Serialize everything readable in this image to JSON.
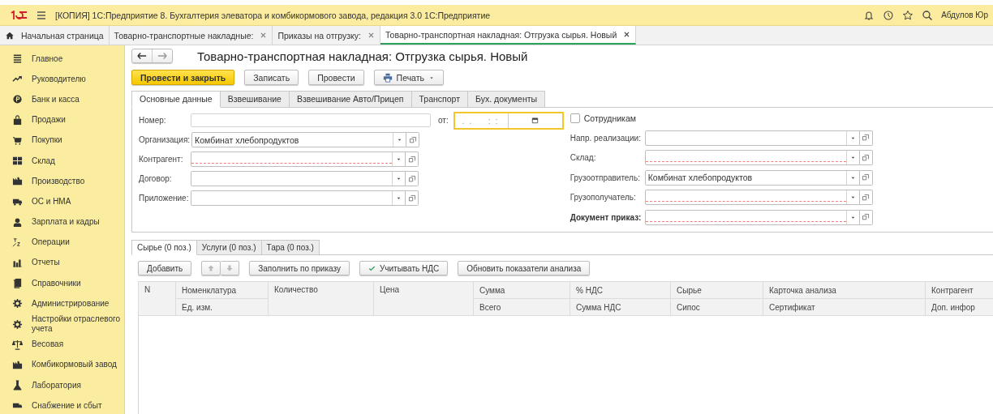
{
  "title_bar": {
    "title": "[КОПИЯ] 1С:Предприятие 8. Бухгалтерия элеватора и комбикормового завода, редакция 3.0 1С:Предприятие",
    "user": "Абдулов Юр"
  },
  "open_tabs": [
    {
      "label": "Начальная страница",
      "kind": "home",
      "selected": false
    },
    {
      "label": "Товарно-транспортные накладные:",
      "kind": "closable",
      "selected": false
    },
    {
      "label": "Приказы на отгрузку:",
      "kind": "closable",
      "selected": false
    },
    {
      "label": "Товарно-транспортная накладная: Отгрузка сырья. Новый",
      "kind": "closable",
      "selected": true
    }
  ],
  "sidebar": {
    "items": [
      {
        "label": "Главное"
      },
      {
        "label": "Руководителю"
      },
      {
        "label": "Банк и касса"
      },
      {
        "label": "Продажи"
      },
      {
        "label": "Покупки"
      },
      {
        "label": "Склад"
      },
      {
        "label": "Производство"
      },
      {
        "label": "ОС и НМА"
      },
      {
        "label": "Зарплата и кадры"
      },
      {
        "label": "Операции"
      },
      {
        "label": "Отчеты"
      },
      {
        "label": "Справочники"
      },
      {
        "label": "Администрирование"
      },
      {
        "label": "Настройки отраслевого учета"
      },
      {
        "label": "Весовая"
      },
      {
        "label": "Комбикормовый завод"
      },
      {
        "label": "Лаборатория"
      },
      {
        "label": "Снабжение и сбыт"
      }
    ]
  },
  "document": {
    "title": "Товарно-транспортная накладная: Отгрузка сырья. Новый",
    "buttons": [
      {
        "label": "Провести и закрыть",
        "kind": "primary"
      },
      {
        "label": "Записать",
        "kind": "plain"
      },
      {
        "label": "Провести",
        "kind": "plain"
      },
      {
        "label": "Печать",
        "kind": "menu"
      }
    ],
    "tabs": [
      {
        "label": "Основные данные",
        "selected": true
      },
      {
        "label": "Взвешивание",
        "selected": false
      },
      {
        "label": "Взвешивание Авто/Прицеп",
        "selected": false
      },
      {
        "label": "Транспорт",
        "selected": false
      },
      {
        "label": "Бух. документы",
        "selected": false
      }
    ],
    "number": {
      "label": "Номер:",
      "date_label": "от:",
      "date_value": " .  .       :  :",
      "date_focused": true
    },
    "left_fields": [
      {
        "label": "Организация:",
        "value": "Комбинат хлебопродуктов",
        "required": false
      },
      {
        "label": "Контрагент:",
        "required": true
      },
      {
        "label": "Договор:",
        "required": false
      },
      {
        "label": "Приложение:",
        "required": false
      }
    ],
    "employees_checkbox": {
      "label": "Сотрудникам",
      "checked": false
    },
    "right_fields": [
      {
        "label": "Напр. реализации:",
        "required": false,
        "bold": false
      },
      {
        "label": "Склад:",
        "required": true,
        "bold": false
      },
      {
        "label": "Грузоотправитель:",
        "value": "Комбинат хлебопродуктов",
        "required": false,
        "bold": false
      },
      {
        "label": "Грузополучатель:",
        "required": true,
        "bold": false
      },
      {
        "label": "Документ приказ:",
        "required": true,
        "bold": true
      }
    ]
  },
  "items_section": {
    "tabs": [
      {
        "label": "Сырье (0 поз.)",
        "selected": true
      },
      {
        "label": "Услуги (0 поз.)",
        "selected": false
      },
      {
        "label": "Тара (0 поз.)",
        "selected": false
      }
    ],
    "toolbar": [
      {
        "label": "Добавить",
        "kind": "plain"
      },
      {
        "kind": "arrows",
        "disabled": true
      },
      {
        "label": "Заполнить по приказу",
        "kind": "plain"
      },
      {
        "label": "Учитывать НДС",
        "kind": "check"
      },
      {
        "label": "Обновить показатели анализа",
        "kind": "plain"
      }
    ],
    "table": {
      "columns": [
        {
          "header": "N"
        },
        {
          "header": "Номенклатура",
          "subheader": "Ед. изм."
        },
        {
          "header": "Количество"
        },
        {
          "header": "Цена"
        },
        {
          "header": "Сумма",
          "subheader": "Всего"
        },
        {
          "header": "% НДС",
          "subheader": "Сумма НДС"
        },
        {
          "header": "Сырье",
          "subheader": "Сипос"
        },
        {
          "header": "Карточка анализа",
          "subheader": "Сертификат"
        },
        {
          "header": "Контрагент",
          "subheader": "Доп. инфор"
        }
      ]
    }
  }
}
